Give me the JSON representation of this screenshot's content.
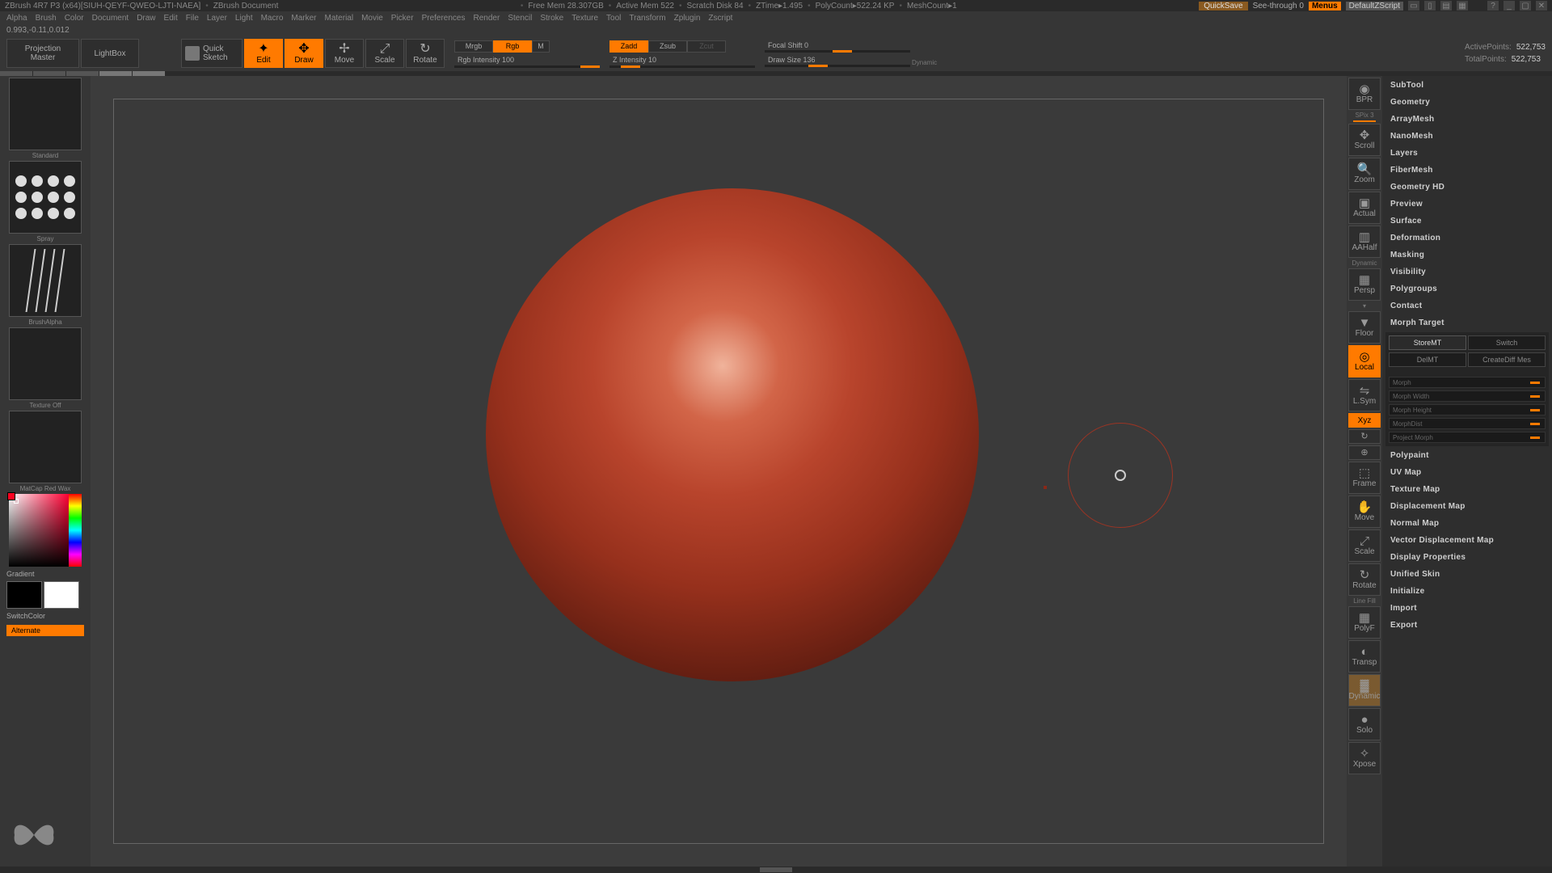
{
  "title": {
    "app": "ZBrush 4R7 P3 (x64)[SIUH-QEYF-QWEO-LJTI-NAEA]",
    "doc": "ZBrush Document",
    "mem": "Free Mem 28.307GB",
    "amem": "Active Mem 522",
    "scratch": "Scratch Disk 84",
    "ztime": "ZTime▸1.495",
    "polycount": "PolyCount▸522.24 KP",
    "meshcount": "MeshCount▸1",
    "quicksave": "QuickSave",
    "see_through": "See-through  0",
    "menus": "Menus",
    "script": "DefaultZScript"
  },
  "menus": [
    "Alpha",
    "Brush",
    "Color",
    "Document",
    "Draw",
    "Edit",
    "File",
    "Layer",
    "Light",
    "Macro",
    "Marker",
    "Material",
    "Movie",
    "Picker",
    "Preferences",
    "Render",
    "Stencil",
    "Stroke",
    "Texture",
    "Tool",
    "Transform",
    "Zplugin",
    "Zscript"
  ],
  "status_coords": "0.993,-0.11,0.012",
  "toolbar": {
    "projection_master_l1": "Projection",
    "projection_master_l2": "Master",
    "lightbox": "LightBox",
    "quicksketch_l1": "Quick",
    "quicksketch_l2": "Sketch",
    "modes": {
      "edit": "Edit",
      "draw": "Draw",
      "move": "Move",
      "scale": "Scale",
      "rotate": "Rotate"
    },
    "mrgb": "Mrgb",
    "rgb": "Rgb",
    "m": "M",
    "rgb_intensity": "Rgb Intensity 100",
    "zadd": "Zadd",
    "zsub": "Zsub",
    "zcut": "Zcut",
    "z_intensity": "Z Intensity 10",
    "focal_shift": "Focal Shift 0",
    "draw_size": "Draw Size 136",
    "dynamic": "Dynamic"
  },
  "stats": {
    "active_label": "ActivePoints:",
    "active_val": "522,753",
    "total_label": "TotalPoints:",
    "total_val": "522,753"
  },
  "left": {
    "brush_label": "Standard",
    "alpha_label": "Spray",
    "stroke_label": "BrushAlpha",
    "texture_label": "Texture Off",
    "material_label": "MatCap Red Wax",
    "gradient": "Gradient",
    "switch_color": "SwitchColor",
    "alternate": "Alternate"
  },
  "right_stack": {
    "bpr": "BPR",
    "spix": "SPix 3",
    "scroll": "Scroll",
    "zoom": "Zoom",
    "actual": "Actual",
    "aahalf": "AAHalf",
    "dynamic": "Dynamic",
    "persp": "Persp",
    "floor": "Floor",
    "local": "Local",
    "lsym": "L.Sym",
    "xyz": "Xyz",
    "frame": "Frame",
    "move": "Move",
    "scale": "Scale",
    "rotate": "Rotate",
    "linefill": "Line Fill",
    "polyf": "PolyF",
    "transp": "Transp",
    "ghost": "Dynamic",
    "solo": "Solo",
    "xpose": "Xpose"
  },
  "panel": {
    "sections": [
      "SubTool",
      "Geometry",
      "ArrayMesh",
      "NanoMesh",
      "Layers",
      "FiberMesh",
      "Geometry HD",
      "Preview",
      "Surface",
      "Deformation",
      "Masking",
      "Visibility",
      "Polygroups",
      "Contact"
    ],
    "morph_target": "Morph Target",
    "store_mt": "StoreMT",
    "switch": "Switch",
    "del_mt": "DelMT",
    "create_diff": "CreateDiff Mes",
    "morph": "Morph",
    "morph_width": "Morph Width",
    "morph_height": "Morph Height",
    "morph_dist": "MorphDist",
    "project_morph": "Project Morph",
    "sections2": [
      "Polypaint",
      "UV Map",
      "Texture Map",
      "Displacement Map",
      "Normal Map",
      "Vector Displacement Map",
      "Display Properties",
      "Unified Skin",
      "Initialize",
      "Import",
      "Export"
    ]
  }
}
